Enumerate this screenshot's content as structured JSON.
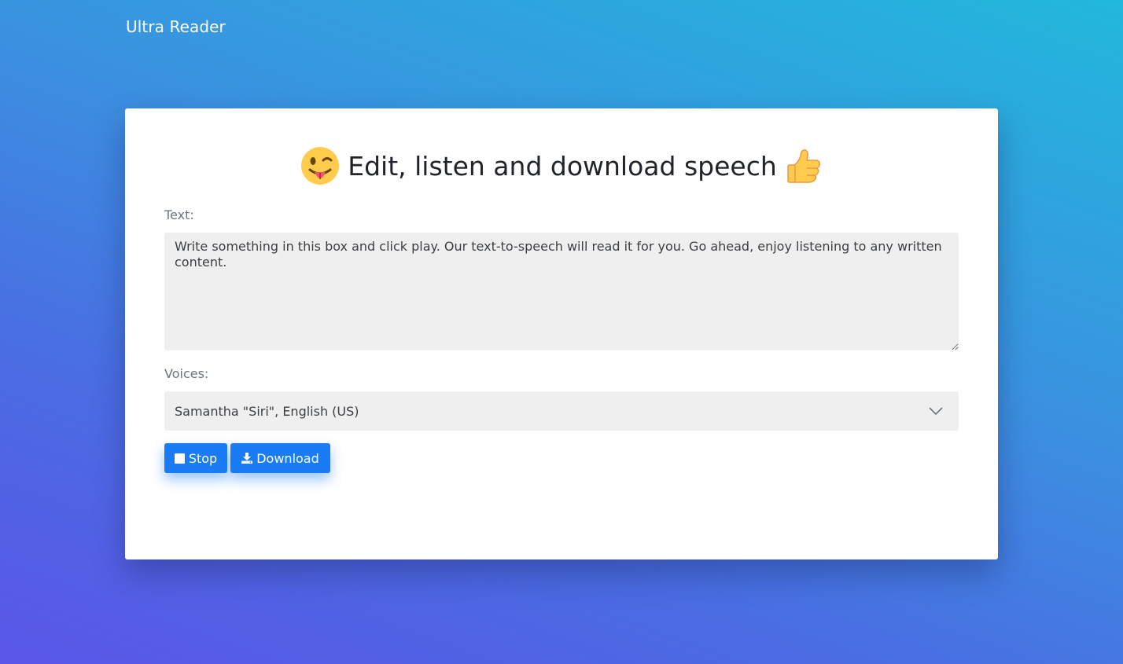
{
  "app": {
    "brand": "Ultra Reader"
  },
  "card": {
    "heading": "Edit, listen and download speech",
    "heading_emoji_left": "winking-face-with-tongue",
    "heading_emoji_right": "thumbs-up"
  },
  "text_field": {
    "label": "Text:",
    "value": "Write something in this box and click play. Our text-to-speech will read it for you. Go ahead, enjoy listening to any written content."
  },
  "voices": {
    "label": "Voices:",
    "selected": "Samantha \"Siri\", English (US)"
  },
  "buttons": {
    "stop_label": "Stop",
    "stop_icon": "stop-square-icon",
    "download_label": "Download",
    "download_icon": "download-icon"
  },
  "colors": {
    "accent": "#1a7cf5",
    "gradient_start": "#5a56e8",
    "gradient_end": "#22b8dc"
  }
}
